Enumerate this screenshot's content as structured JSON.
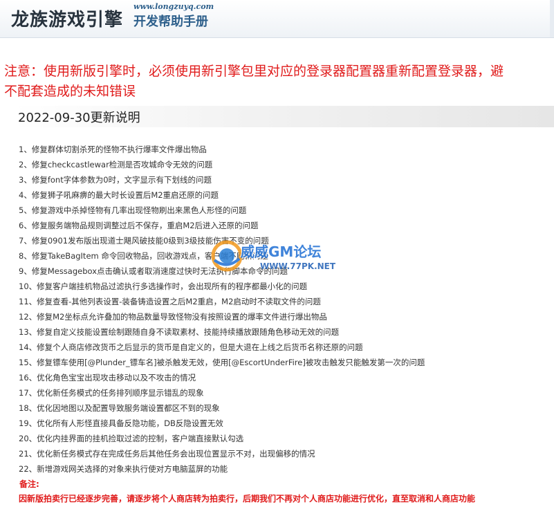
{
  "header": {
    "logo_text": "龙族游戏引擎",
    "url": "www.longzuyq.com",
    "subtitle": "开发帮助手册"
  },
  "notice": {
    "line1": "注意：使用新版引擎时，必须使用新引擎包里对应的登录器配置器重新配置登录器，避",
    "line2": "不配套造成的未知错误"
  },
  "update": {
    "title": "2022-09-30更新说明",
    "items": [
      "1、修复群体切割杀死的怪物不执行爆率文件爆出物品",
      "2、修复checkcastlewar检测是否攻城命令无效的问题",
      "3、修复font字体参数为0时，文字显示有下划线的问题",
      "4、修复狮子吼麻痹的最大时长设置后M2重启还原的问题",
      "5、修复游戏中杀掉怪物有几率出现怪物刷出来黑色人形怪的问题",
      "6、修复服务端物品规则调整过后不保存，重启M2后进入还原的问题",
      "7、修复0901发布版出现道士飓风破技能0级到3级技能伤害不变的问题",
      "8、修复TakeBagItem 命令回收物品，回收游戏点，客户端不刷新问题",
      "9、修复Messagebox点击确认或者取消速度过快时无法执行脚本命令的问题",
      "10、修复客户端挂机物品过滤执行多选操作时，会出现所有的程序都最小化的问题",
      "11、修复查看-其他列表设置-装备铸造设置之后M2重启，M2启动时不读取文件的问题",
      "12、修复M2坐标点允许叠加的物品数量导致怪物没有按照设置的爆率文件进行爆出物品",
      "13、修复自定义技能设置绘制跟随自身不读取素材、技能持续播放跟随角色移动无效的问题",
      "14、修复个人商店修改货币之后显示的货币是自定义的，但是大退在上线之后货币名称还原的问题",
      "15、修复镖车使用[@Plunder_镖车名]被杀触发无效，使用[@EscortUnderFire]被攻击触发只能触发第一次的问题",
      "16、优化角色宝宝出现攻击移动以及不攻击的情况",
      "17、优化新任务模式的任务排列顺序显示错乱的现象",
      "18、优化因地图以及配置导致服务端设置都区不到的现象",
      "19、优化所有人形怪直接具备反隐功能，DB反隐设置无效",
      "20、优化内挂界面的挂机捡取过滤的控制，客户端直接默认勾选",
      "21、优化新任务模式存在完成任务后其他任务会出现位置显示不对，出现偏移的情况",
      "22、新增游戏网关选择的对象来执行使对方电脑蓝屏的功能"
    ],
    "footnote_label": "备注:",
    "footnote": "因新版拍卖行已经逐步完善，请逐步将个人商店转为拍卖行，后期我们不再对个人商店功能进行优化，直至取消和人商店功能"
  },
  "watermark": {
    "text1": "威威GM论坛",
    "text2": "WWW.77PK.NET"
  }
}
